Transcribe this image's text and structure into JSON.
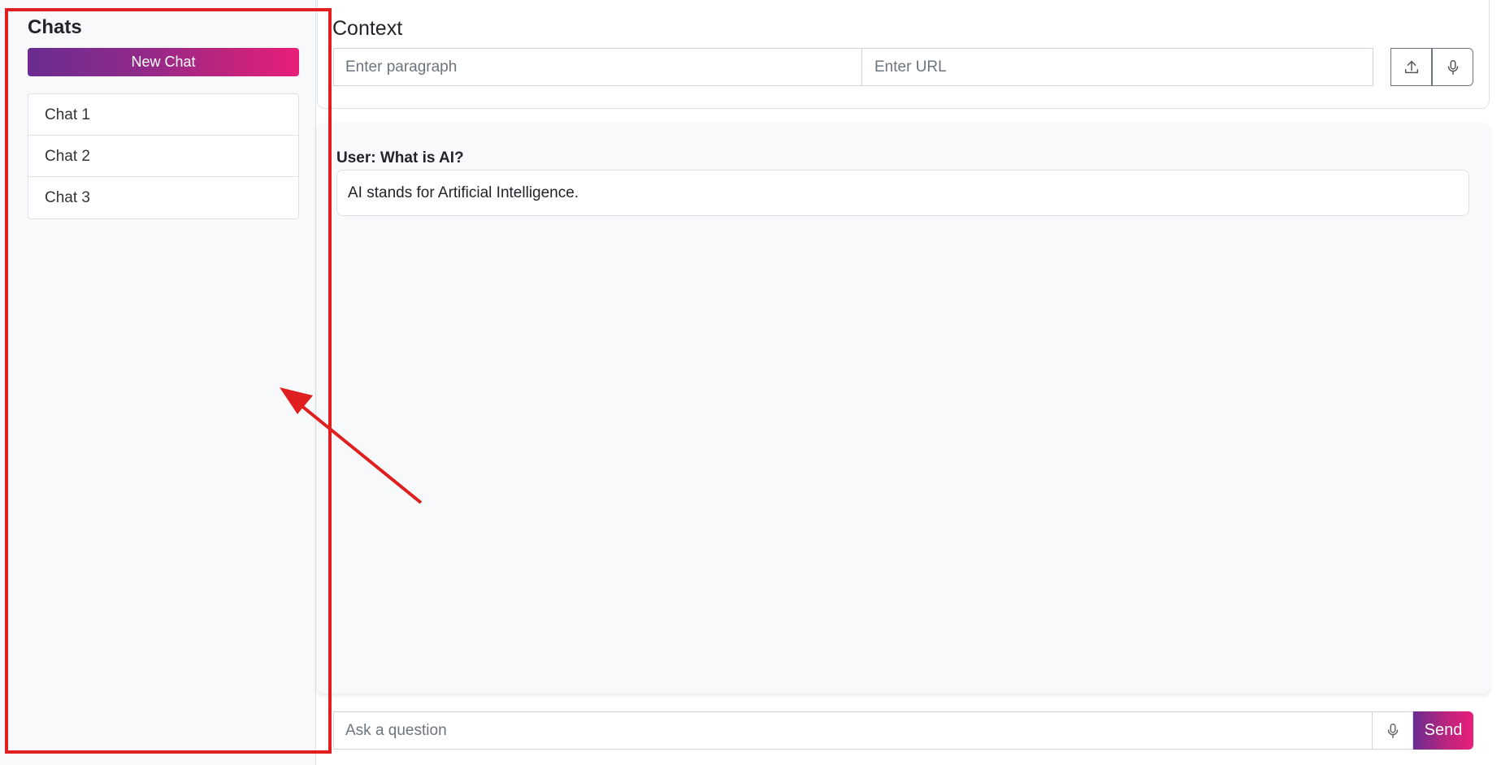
{
  "sidebar": {
    "title": "Chats",
    "new_chat_label": "New Chat",
    "chats": [
      "Chat 1",
      "Chat 2",
      "Chat 3"
    ]
  },
  "context": {
    "title": "Context",
    "paragraph_placeholder": "Enter paragraph",
    "url_placeholder": "Enter URL",
    "upload_icon": "upload-icon",
    "mic_icon": "microphone-icon"
  },
  "conversation": {
    "user_message": "User: What is AI?",
    "ai_response": "AI stands for Artificial Intelligence."
  },
  "composer": {
    "placeholder": "Ask a question",
    "mic_icon": "microphone-icon",
    "send_label": "Send"
  },
  "colors": {
    "gradient_start": "#6a2c91",
    "gradient_end": "#e91e7a",
    "annotation": "#e02020"
  }
}
